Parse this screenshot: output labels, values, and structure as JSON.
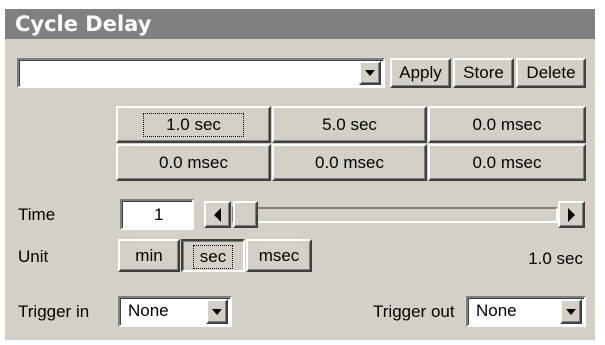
{
  "window": {
    "title": "Cycle Delay"
  },
  "preset_bar": {
    "preset_value": "",
    "apply_label": "Apply",
    "store_label": "Store",
    "delete_label": "Delete"
  },
  "presets": [
    "1.0 sec",
    "5.0 sec",
    "0.0 msec",
    "0.0 msec",
    "0.0 msec",
    "0.0 msec"
  ],
  "time": {
    "label": "Time",
    "value": "1"
  },
  "unit": {
    "label": "Unit",
    "options": [
      "min",
      "sec",
      "msec"
    ],
    "selected": "sec",
    "readout": "1.0 sec"
  },
  "trigger_in": {
    "label": "Trigger in",
    "value": "None"
  },
  "trigger_out": {
    "label": "Trigger out",
    "value": "None"
  }
}
